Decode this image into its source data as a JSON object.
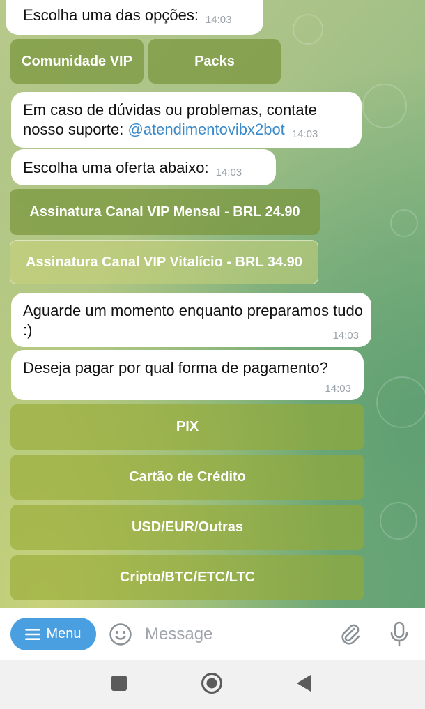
{
  "messages": [
    {
      "text": "Escolha uma das opções:",
      "time": "14:03"
    },
    {
      "text_line1": "Em caso de dúvidas ou problemas, contate",
      "text_prefix": "nosso suporte: ",
      "mention": "@atendimentovibx2bot",
      "time": "14:03"
    },
    {
      "text": "Escolha uma oferta abaixo:",
      "time": "14:03"
    },
    {
      "text": "Aguarde um momento enquanto preparamos tudo :)",
      "time": "14:03"
    },
    {
      "text": "Deseja pagar por qual forma de pagamento?",
      "time": "14:03"
    }
  ],
  "keyboards": {
    "options": [
      "Comunidade VIP",
      "Packs"
    ],
    "offers": [
      "Assinatura Canal VIP Mensal - BRL 24.90",
      "Assinatura Canal VIP Vitalício - BRL 34.90"
    ],
    "payment": [
      "PIX",
      "Cartão de Crédito",
      "USD/EUR/Outras",
      "Cripto/BTC/ETC/LTC"
    ]
  },
  "input": {
    "menu_label": "Menu",
    "placeholder": "Message"
  },
  "icons": {
    "menu": "hamburger-icon",
    "emoji": "emoji-icon",
    "attach": "paperclip-icon",
    "voice": "microphone-icon",
    "nav_recent": "square-icon",
    "nav_home": "circle-icon",
    "nav_back": "triangle-back-icon"
  },
  "colors": {
    "accent": "#4a9fe0",
    "link": "#3a89c9"
  }
}
